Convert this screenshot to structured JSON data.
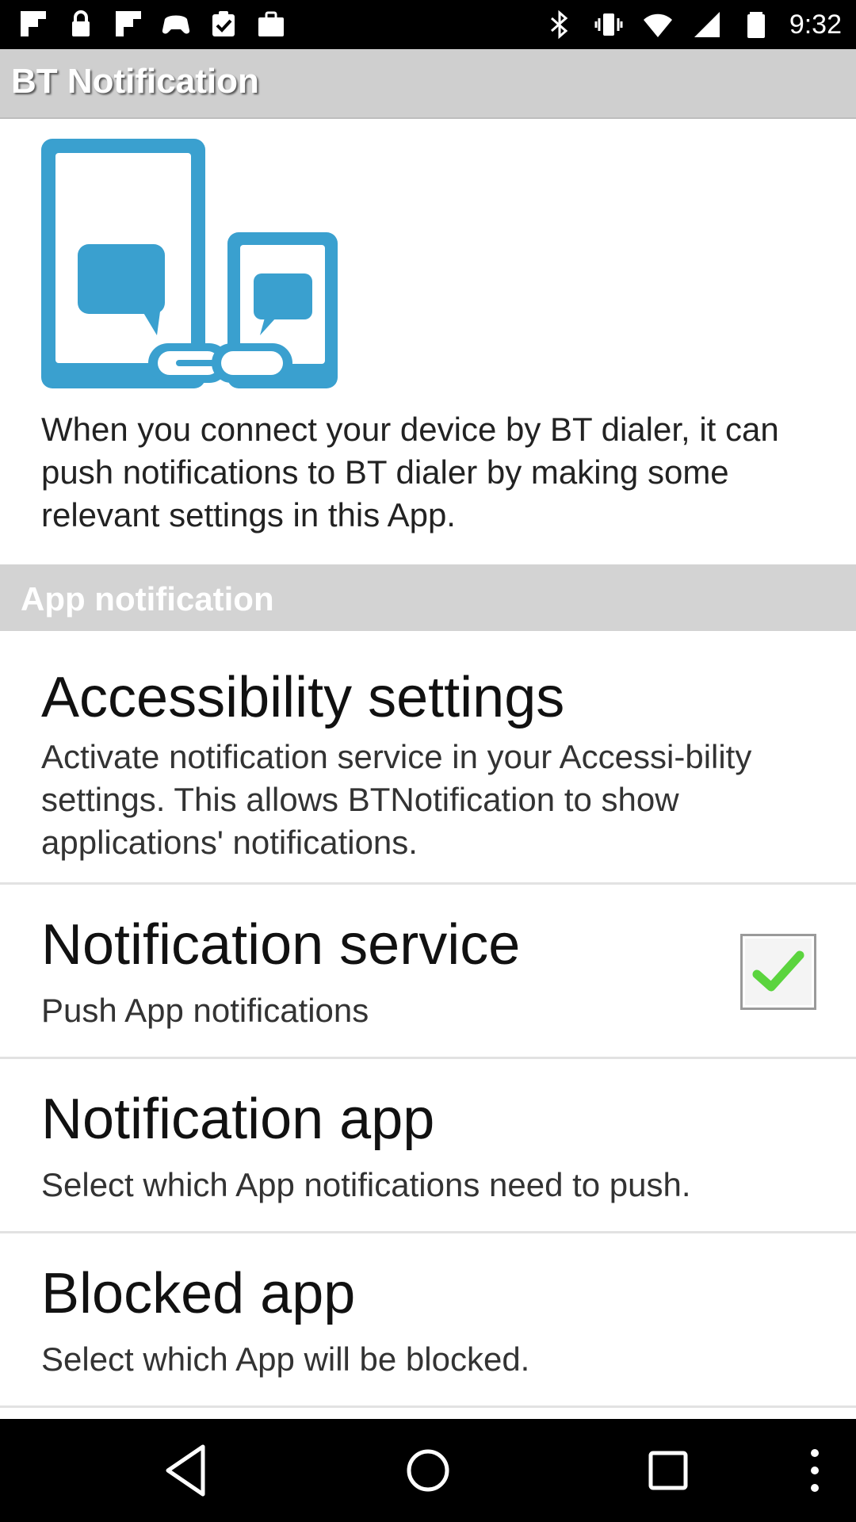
{
  "status_bar": {
    "time": "9:32",
    "left_icons": [
      "flipboard-icon",
      "lock-icon",
      "flipboard-icon",
      "game-controller-icon",
      "clipboard-check-icon",
      "briefcase-icon"
    ],
    "right_icons": [
      "bluetooth-icon",
      "vibrate-icon",
      "wifi-icon",
      "signal-icon",
      "battery-icon"
    ]
  },
  "title_bar": {
    "title": "BT Notification"
  },
  "hero": {
    "icon": "devices-chat-link-icon",
    "color": "#3aa0cf"
  },
  "intro_text": "When you connect your device by BT dialer, it can push notifications to BT dialer by making some relevant settings in this App.",
  "section": {
    "label": "App notification"
  },
  "preferences": [
    {
      "title": "Accessibility settings",
      "summary": "Activate notification service in your Accessi-bility settings. This allows BTNotification to show applications' notifications."
    },
    {
      "title": "Notification service",
      "summary": "Push App notifications",
      "checked": true
    },
    {
      "title": "Notification app",
      "summary": "Select which App notifications need to push."
    },
    {
      "title": "Blocked app",
      "summary": "Select which App will be blocked."
    }
  ],
  "colors": {
    "accent_check": "#5bd43e",
    "section_bg": "#d3d3d3",
    "title_bg": "#cfcfcf"
  },
  "nav_bar": {
    "buttons": [
      "back-icon",
      "home-icon",
      "recents-icon",
      "more-icon"
    ]
  }
}
